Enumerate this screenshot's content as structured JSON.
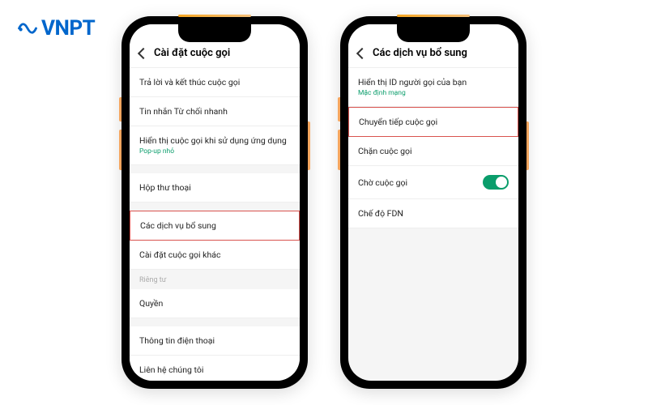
{
  "logo": {
    "text": "VNPT"
  },
  "phone1": {
    "header": {
      "title": "Cài đặt cuộc gọi"
    },
    "items": [
      {
        "label": "Trả lời và kết thúc cuộc gọi"
      },
      {
        "label": "Tin nhắn Từ chối nhanh"
      },
      {
        "label": "Hiển thị cuộc gọi khi sử dụng ứng dụng",
        "sub": "Pop-up nhỏ"
      },
      {
        "label": "Hộp thư thoại"
      },
      {
        "label": "Các dịch vụ bổ sung"
      },
      {
        "label": "Cài đặt cuộc gọi khác"
      }
    ],
    "section_header": "Riêng tư",
    "items2": [
      {
        "label": "Quyền"
      },
      {
        "label": "Thông tin điện thoại"
      },
      {
        "label": "Liên hệ chúng tôi"
      }
    ]
  },
  "phone2": {
    "header": {
      "title": "Các dịch vụ bổ sung"
    },
    "items": [
      {
        "label": "Hiển thị ID người gọi của bạn",
        "sub": "Mặc định mạng"
      },
      {
        "label": "Chuyển tiếp cuộc gọi"
      },
      {
        "label": "Chặn cuộc gọi"
      },
      {
        "label": "Chờ cuộc gọi"
      },
      {
        "label": "Chế độ FDN"
      }
    ]
  }
}
